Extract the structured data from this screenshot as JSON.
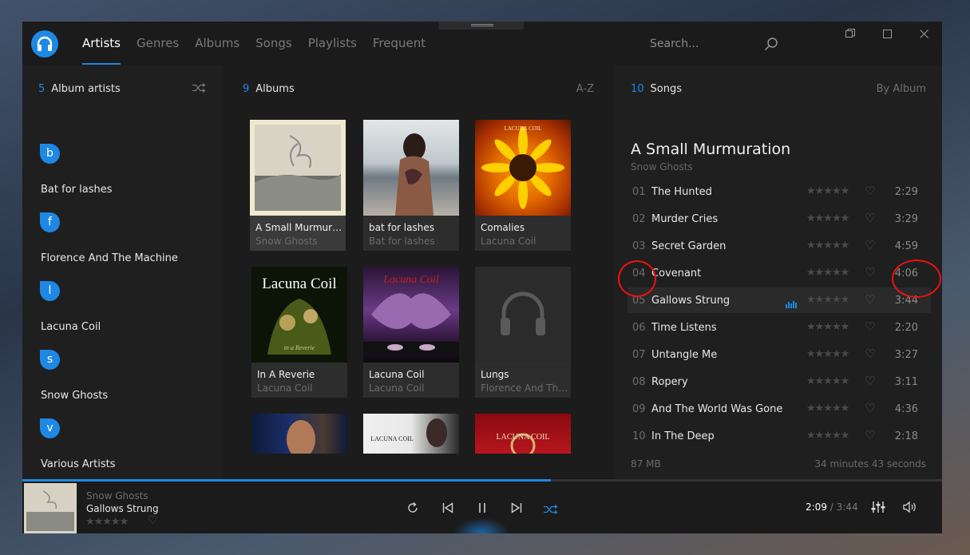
{
  "nav": {
    "tabs": [
      "Artists",
      "Genres",
      "Albums",
      "Songs",
      "Playlists",
      "Frequent"
    ],
    "search_placeholder": "Search..."
  },
  "artists": {
    "count": "5",
    "label": "Album artists",
    "groups": [
      {
        "letter": "b",
        "name": "Bat for lashes"
      },
      {
        "letter": "f",
        "name": "Florence And The Machine"
      },
      {
        "letter": "l",
        "name": "Lacuna Coil"
      },
      {
        "letter": "s",
        "name": "Snow Ghosts"
      },
      {
        "letter": "v",
        "name": "Various Artists"
      }
    ]
  },
  "albums": {
    "count": "9",
    "label": "Albums",
    "sort": "A-Z",
    "items": [
      {
        "title": "A Small Murmuration",
        "artist": "Snow Ghosts"
      },
      {
        "title": "bat for lashes",
        "artist": "Bat for lashes"
      },
      {
        "title": "Comalies",
        "artist": "Lacuna Coil"
      },
      {
        "title": "In A Reverie",
        "artist": "Lacuna Coil"
      },
      {
        "title": "Lacuna Coil",
        "artist": "Lacuna Coil"
      },
      {
        "title": "Lungs",
        "artist": "Florence And The Machine"
      },
      {
        "title": "",
        "artist": ""
      },
      {
        "title": "",
        "artist": ""
      },
      {
        "title": "",
        "artist": ""
      }
    ],
    "cover_text": {
      "comalies": "LACUNA COIL",
      "reverie": "Lacuna Coil",
      "reverie_sub": "in a Reverie",
      "lc_top": "Lacuna Coil",
      "row3_b": "LACUNA COIL",
      "row3_c": "LACUNA COIL"
    }
  },
  "songs": {
    "count": "10",
    "label": "Songs",
    "sort": "By Album",
    "album_title": "A Small Murmuration",
    "album_artist": "Snow Ghosts",
    "items": [
      {
        "num": "01",
        "name": "The Hunted",
        "dur": "2:29"
      },
      {
        "num": "02",
        "name": "Murder Cries",
        "dur": "3:29"
      },
      {
        "num": "03",
        "name": "Secret Garden",
        "dur": "4:59"
      },
      {
        "num": "04",
        "name": "Covenant",
        "dur": "4:06"
      },
      {
        "num": "05",
        "name": "Gallows Strung",
        "dur": "3:44"
      },
      {
        "num": "06",
        "name": "Time Listens",
        "dur": "2:20"
      },
      {
        "num": "07",
        "name": "Untangle Me",
        "dur": "3:27"
      },
      {
        "num": "08",
        "name": "Ropery",
        "dur": "3:11"
      },
      {
        "num": "09",
        "name": "And The World Was Gone",
        "dur": "4:36"
      },
      {
        "num": "10",
        "name": "In The Deep",
        "dur": "2:18"
      }
    ],
    "playing_index": 4,
    "rating_stars": "★★★★★",
    "size": "87 MB",
    "total_length": "34 minutes 43 seconds"
  },
  "player": {
    "artist": "Snow Ghosts",
    "title": "Gallows Strung",
    "stars": "★★★★★",
    "position": "2:09",
    "duration": "3:44",
    "progress_fraction": 0.575
  },
  "colors": {
    "accent": "#1e88e5",
    "annotation": "#e11111"
  },
  "icons": [
    "headphones-logo-icon",
    "search-icon",
    "restore-icon",
    "maximize-icon",
    "close-icon",
    "shuffle-icon",
    "heart-icon",
    "equalizer-icon",
    "repeat-icon",
    "previous-icon",
    "pause-icon",
    "next-icon",
    "mixer-icon",
    "volume-icon"
  ]
}
